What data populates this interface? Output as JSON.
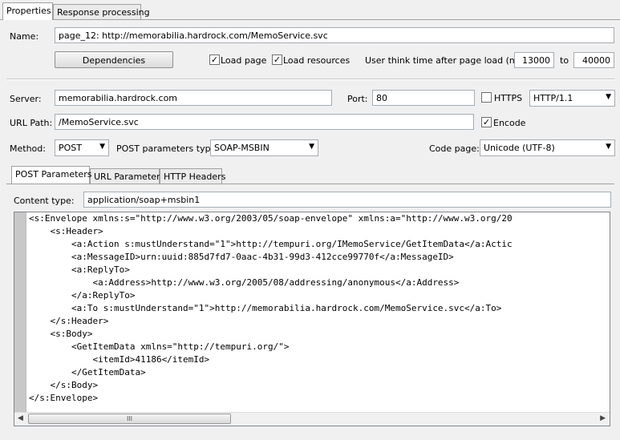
{
  "tabs": [
    "Properties",
    "Response processing"
  ],
  "name": {
    "label": "Name:",
    "value": "page_12: http://memorabilia.hardrock.com/MemoService.svc"
  },
  "dependencies_button": "Dependencies",
  "load_page": {
    "label": "Load page",
    "checked": true
  },
  "load_resources": {
    "label": "Load resources",
    "checked": true
  },
  "think_time": {
    "label": "User think time after page load (ms):",
    "min": "13000",
    "to_label": "to",
    "max": "40000"
  },
  "server": {
    "label": "Server:",
    "value": "memorabilia.hardrock.com"
  },
  "port": {
    "label": "Port:",
    "value": "80"
  },
  "https": {
    "label": "HTTPS",
    "checked": false
  },
  "http_version": {
    "value": "HTTP/1.1"
  },
  "url_path": {
    "label": "URL Path:",
    "value": "/MemoService.svc"
  },
  "encode": {
    "label": "Encode",
    "checked": true
  },
  "method": {
    "label": "Method:",
    "value": "POST"
  },
  "post_params_type": {
    "label": "POST parameters type:",
    "value": "SOAP-MSBIN"
  },
  "code_page": {
    "label": "Code page:",
    "value": "Unicode (UTF-8)"
  },
  "sub_tabs": [
    "POST Parameters",
    "URL Parameters",
    "HTTP Headers"
  ],
  "content_type": {
    "label": "Content type:",
    "value": "application/soap+msbin1"
  },
  "body_lines": [
    "<s:Envelope xmlns:s=\"http://www.w3.org/2003/05/soap-envelope\" xmlns:a=\"http://www.w3.org/20",
    "    <s:Header>",
    "        <a:Action s:mustUnderstand=\"1\">http://tempuri.org/IMemoService/GetItemData</a:Actic",
    "        <a:MessageID>urn:uuid:885d7fd7-0aac-4b31-99d3-412cce99770f</a:MessageID>",
    "        <a:ReplyTo>",
    "            <a:Address>http://www.w3.org/2005/08/addressing/anonymous</a:Address>",
    "        </a:ReplyTo>",
    "        <a:To s:mustUnderstand=\"1\">http://memorabilia.hardrock.com/MemoService.svc</a:To>",
    "    </s:Header>",
    "    <s:Body>",
    "        <GetItemData xmlns=\"http://tempuri.org/\">",
    "            <itemId>41186</itemId>",
    "        </GetItemData>",
    "    </s:Body>",
    "</s:Envelope>"
  ],
  "icons": {
    "dropdown": "chevron-down-icon",
    "checkbox": "checkmark-icon",
    "scroll_left": "arrow-left-icon",
    "scroll_right": "arrow-right-icon",
    "grip": "grip-icon"
  },
  "scroll_grip": "III",
  "checkmark": "✓",
  "arrow_down": "▼",
  "arrow_left": "◀",
  "arrow_right": "▶"
}
